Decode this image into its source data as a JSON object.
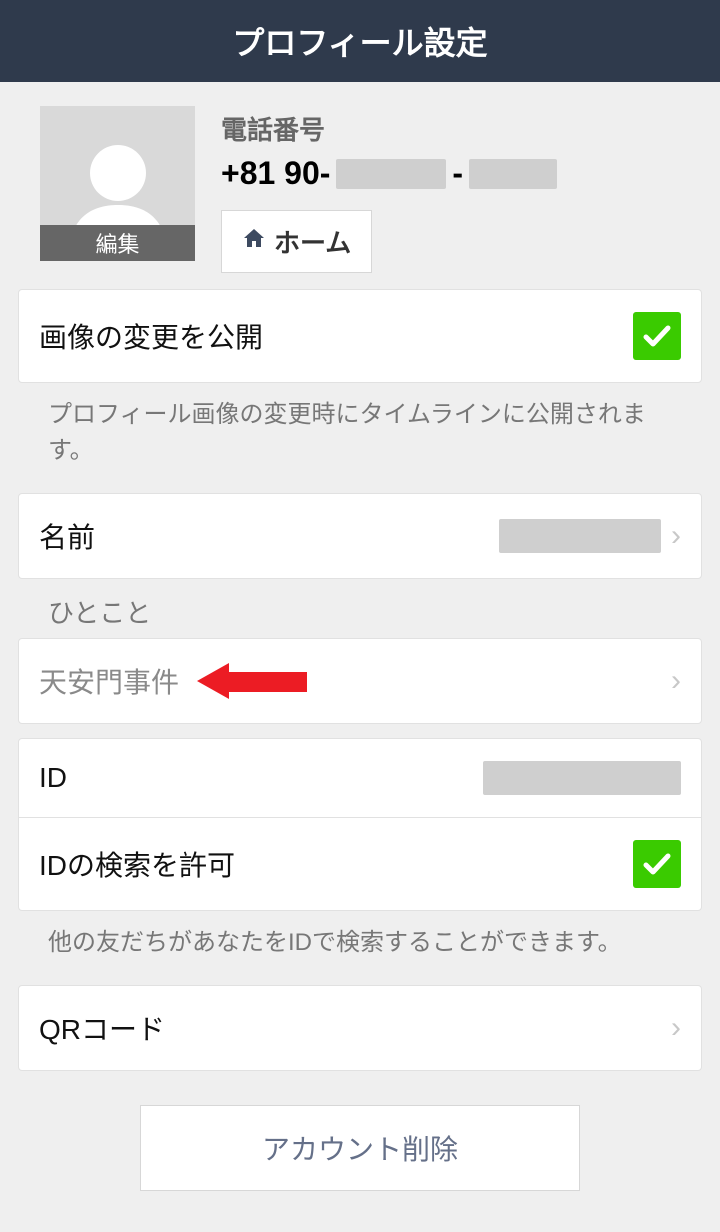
{
  "header": {
    "title": "プロフィール設定"
  },
  "avatar": {
    "edit_label": "編集"
  },
  "phone": {
    "label": "電話番号",
    "prefix": "+81 90-",
    "sep": "-"
  },
  "home_button": {
    "label": "ホーム"
  },
  "rows": {
    "publish_image": {
      "label": "画像の変更を公開"
    },
    "publish_image_help": "プロフィール画像の変更時にタイムラインに公開されます。",
    "name": {
      "label": "名前"
    },
    "status_section": "ひとこと",
    "status_value": "天安門事件",
    "id": {
      "label": "ID"
    },
    "id_search": {
      "label": "IDの検索を許可"
    },
    "id_search_help": "他の友だちがあなたをIDで検索することができます。",
    "qr": {
      "label": "QRコード"
    }
  },
  "delete_button": "アカウント削除"
}
